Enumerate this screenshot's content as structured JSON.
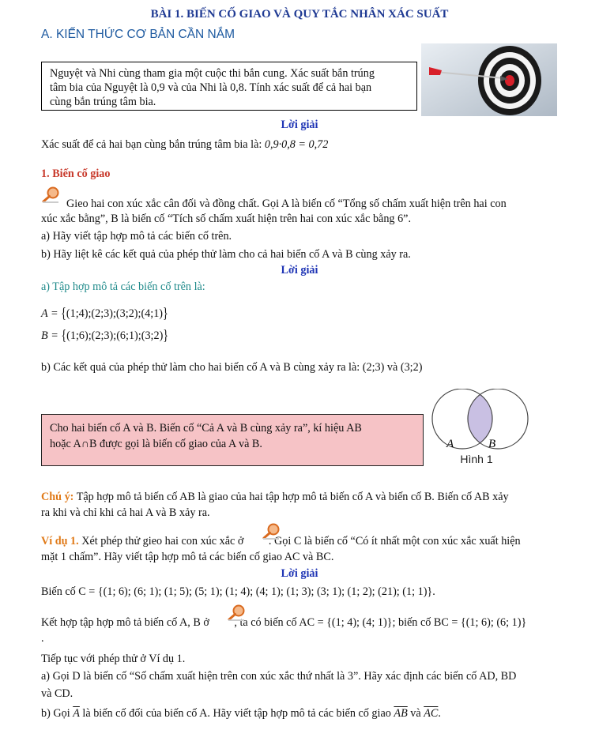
{
  "title": "BÀI 1. BIẾN CỐ GIAO VÀ QUY TẮC NHÂN XÁC SUẤT",
  "section_a": "A. KIẾN THỨC CƠ BẢN CẦN NẮM",
  "intro_box": {
    "line1": "Nguyệt và Nhi cùng tham gia một cuộc thi bắn cung. Xác suất bắn trúng",
    "line2": "tâm bia của Nguyệt là 0,9 và của Nhi là 0,8. Tính xác suất để cả hai bạn",
    "line3": "cùng bắn trúng tâm bia."
  },
  "solution_label": "Lời giải",
  "intro_solution": {
    "text": "Xác suất để cả hai bạn cùng bắn trúng tâm bia là: ",
    "formula": "0,9·0,8 = 0,72"
  },
  "section1_heading": "1. Biến cố giao",
  "activity": {
    "line1": "Gieo hai con xúc xắc cân đối và đồng chất. Gọi A là biến cố “Tổng số chấm xuất hiện trên hai con",
    "line2": "xúc xắc bằng”, B là biến cố “Tích số chấm xuất hiện trên hai con xúc xắc bằng 6”.",
    "qa": "a) Hãy viết tập hợp mô tả các biến cố trên.",
    "qb": "b) Hãy liệt kê các kết quả của phép thử làm cho cả hai biến cố A và B cùng xảy ra."
  },
  "activity_solution": {
    "a_intro": "a) Tập hợp mô tả các biến cố trên là:",
    "set_a_name": "A = ",
    "set_a": "(1;4);(2;3);(3;2);(4;1)",
    "set_b_name": "B = ",
    "set_b": "(1;6);(2;3);(6;1);(3;2)",
    "b_text": "b) Các kết quả của phép thử làm cho hai biến cố A và B cùng xảy ra là: (2;3) và (3;2)"
  },
  "definition_box": {
    "line1": "Cho hai biến cố A và B. Biến cố “Cả A và B cùng xảy ra”, kí hiệu AB",
    "line2": "hoặc A∩B được gọi là biến cố giao của A và B."
  },
  "venn": {
    "label_a": "A",
    "label_b": "B",
    "caption": "Hình 1",
    "intersection_color": "#c9c0e3"
  },
  "note": {
    "label": "Chú ý:",
    "line1": " Tập hợp mô tả biến cố AB là giao của hai tập hợp mô tả biến cố A và biến cố B. Biến cố AB xảy",
    "line2": "ra khi và chỉ khi cả hai A và B xảy ra."
  },
  "example1": {
    "label": "Ví dụ 1.",
    "line1_before_icon": " Xét phép thử gieo hai con xúc xắc ở ",
    "line1_after_icon": ". Gọi C là biến cố “Có ít nhất một con xúc xắc xuất hiện",
    "line2": "mặt 1 chấm”. Hãy viết tập hợp mô tả các biến cố giao AC và BC.",
    "solution_line1": "Biến cố C = {(1; 6); (6; 1); (1; 5); (5; 1); (1; 4); (4; 1); (1; 3); (3; 1); (1; 2); (21); (1; 1)}.",
    "solution_line2_before_icon": "Kết hợp tập hợp mô tả biến cố A, B ở ",
    "solution_line2_after_icon": ", ta có biến cố AC = {(1; 4); (4; 1)}; biến cố BC = {(1; 6); (6; 1)}",
    "period": "."
  },
  "continue": {
    "line1": "Tiếp tục với phép thử ở Ví dụ 1.",
    "line2": "a) Gọi D là biến cố “Số chấm xuất hiện trên con xúc xắc thứ nhất là 3”. Hãy xác định các biến cố AD, BD",
    "line3": "và CD.",
    "line4_before": "b) Gọi ",
    "line4_abar": "A",
    "line4_mid": " là biến cố đối của biến cố A. Hãy viết tập hợp mô tả các biến cố giao ",
    "line4_ab": "AB",
    "line4_and": " và ",
    "line4_ac": "AC",
    "line4_end": "."
  },
  "icon_names": [
    "magnifier-icon"
  ]
}
